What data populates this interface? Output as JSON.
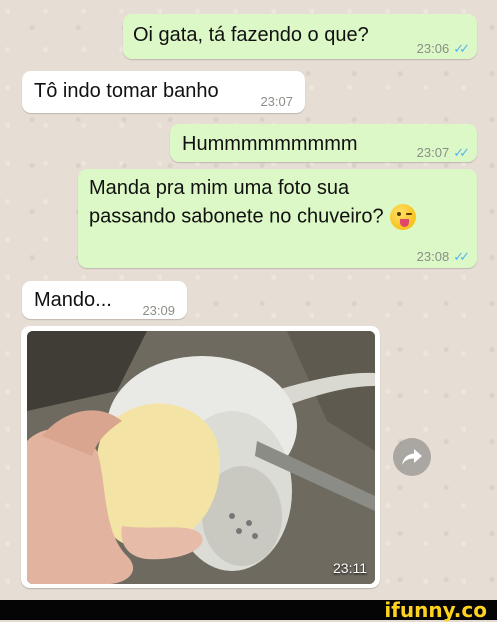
{
  "messages": [
    {
      "text": "Oi gata, tá fazendo o que?",
      "time": "23:06",
      "ticks": "✓✓"
    },
    {
      "text": "Tô indo tomar banho",
      "time": "23:07"
    },
    {
      "text": "Hummmmmmmmm",
      "time": "23:07",
      "ticks": "✓✓"
    },
    {
      "line1": "Manda pra mim uma foto sua",
      "line2": "passando sabonete no chuveiro?",
      "emoji": "winking-face-with-tongue",
      "time": "23:08",
      "ticks": "✓✓"
    },
    {
      "text": "Mando...",
      "time": "23:09"
    },
    {
      "type": "image",
      "time": "23:11"
    }
  ],
  "footer": {
    "brand": "ifunny.co"
  },
  "colors": {
    "outgoing": "#dcf8c6",
    "incoming": "#ffffff",
    "read_ticks": "#4fb6ec",
    "brand": "#ffd21f"
  },
  "icons": {
    "share": "forward-arrow-icon"
  }
}
